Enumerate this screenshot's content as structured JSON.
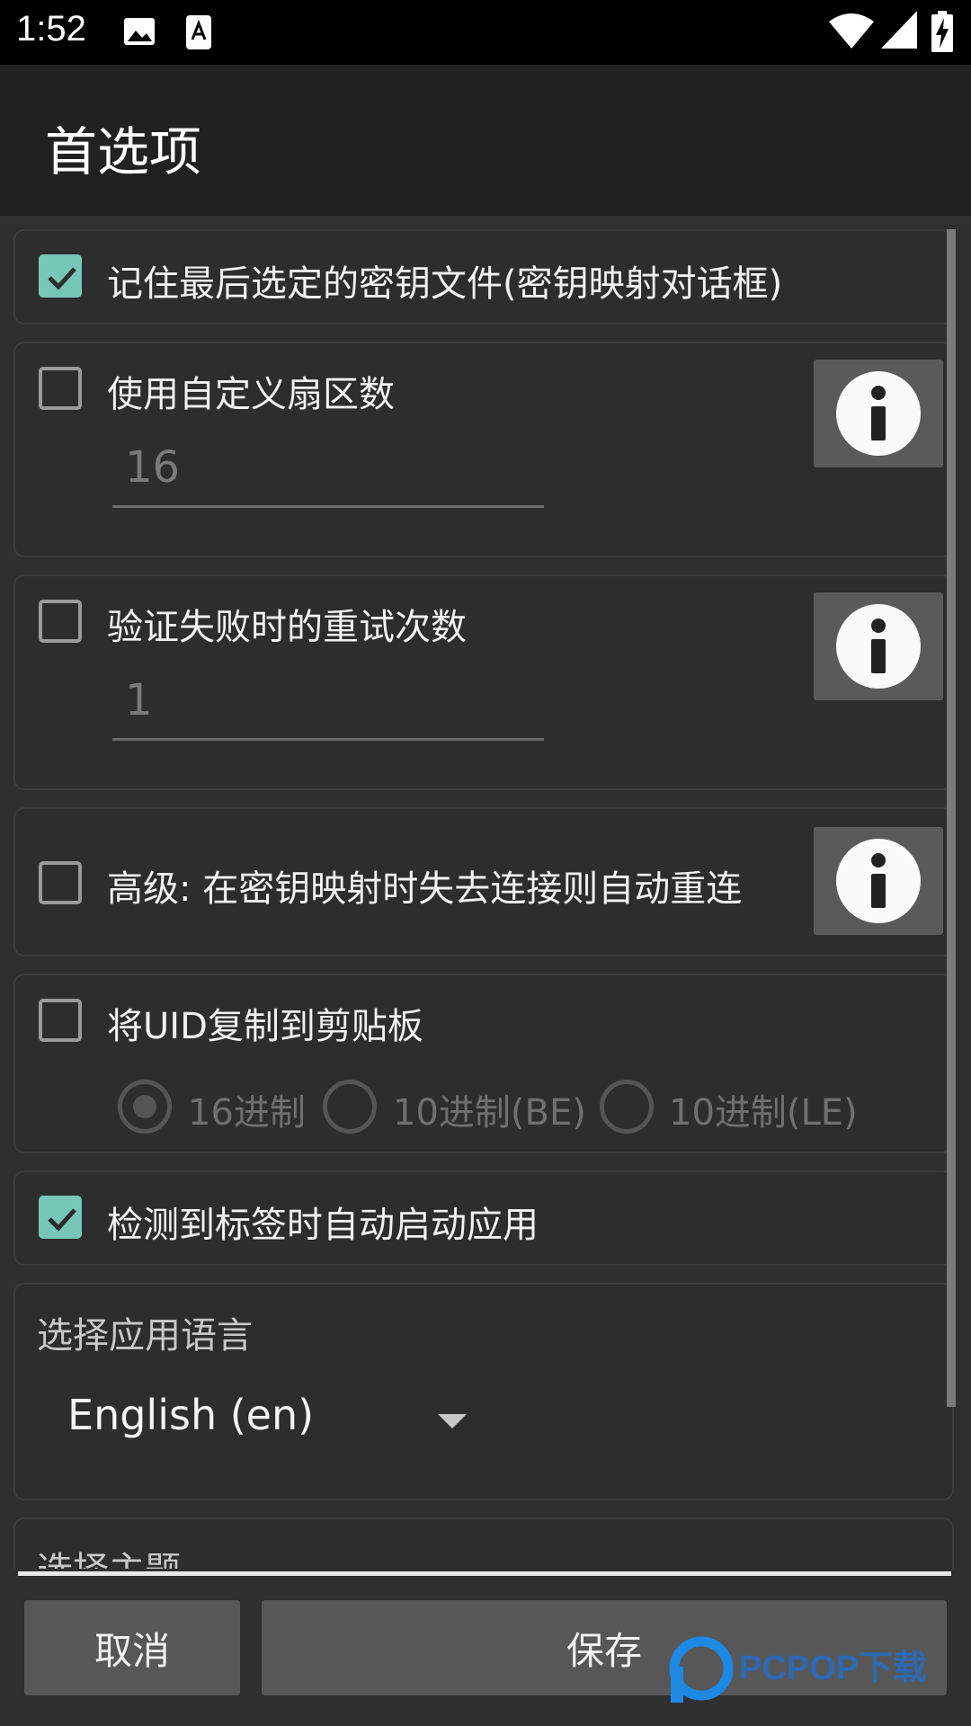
{
  "status_bar": {
    "time": "1:52",
    "icons": [
      "image-icon",
      "font-a-icon",
      "wifi-icon",
      "signal-icon",
      "battery-charging-icon"
    ]
  },
  "app_bar": {
    "title": "首选项"
  },
  "settings": {
    "remember_keyfile": {
      "label": "记住最后选定的密钥文件(密钥映射对话框)",
      "checked": true
    },
    "custom_sectors": {
      "label": "使用自定义扇区数",
      "checked": false,
      "value": "16"
    },
    "retry_count": {
      "label": "验证失败时的重试次数",
      "checked": false,
      "value": "1"
    },
    "auto_reconnect": {
      "label": "高级: 在密钥映射时失去连接则自动重连",
      "checked": false
    },
    "copy_uid": {
      "label": "将UID复制到剪贴板",
      "checked": false,
      "options": [
        "16进制",
        "10进制(BE)",
        "10进制(LE)"
      ],
      "selected": "16进制"
    },
    "auto_launch": {
      "label": "检测到标签时自动启动应用",
      "checked": true
    },
    "language": {
      "title": "选择应用语言",
      "selected": "English (en)"
    },
    "theme": {
      "title": "选择主题"
    }
  },
  "buttons": {
    "cancel": "取消",
    "save": "保存"
  },
  "watermark": {
    "text": "PCPOP下载"
  },
  "colors": {
    "accent": "#76c7b8",
    "background": "#2f2f2f",
    "app_bar": "#212121",
    "button": "#575757"
  }
}
